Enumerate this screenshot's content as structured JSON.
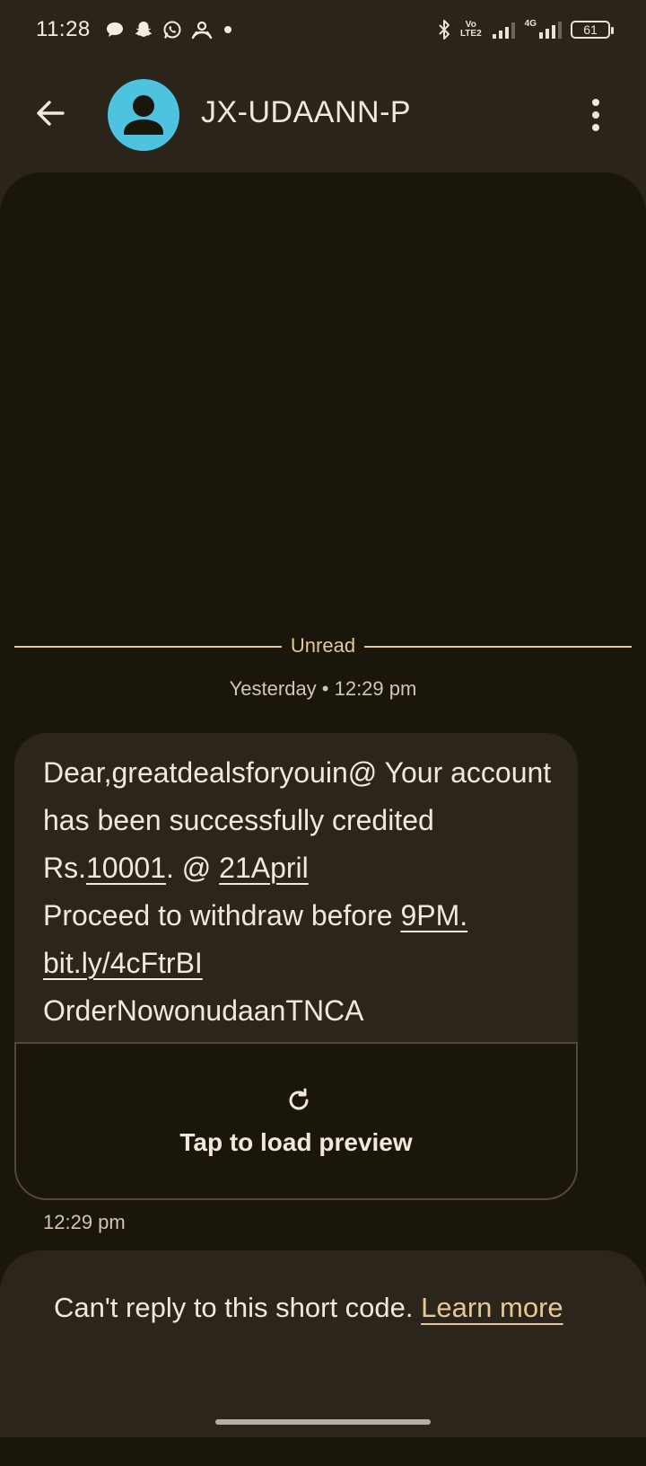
{
  "status_bar": {
    "time": "11:28",
    "network_label_top": "Vo",
    "network_label_bottom": "LTE2",
    "data_label": "4G",
    "battery": "61",
    "left_icons": [
      "chat-bubble-icon",
      "snapchat-icon",
      "whatsapp-icon",
      "app-notification-icon",
      "dot-icon"
    ],
    "right_icons": [
      "bluetooth-icon",
      "volte-icon",
      "signal-icon",
      "signal-4g-icon",
      "battery-icon"
    ]
  },
  "header": {
    "contact_name": "JX-UDAANN-P",
    "avatar_color": "#4dc3e0"
  },
  "conversation": {
    "unread_label": "Unread",
    "date_header": "Yesterday • 12:29 pm",
    "message": {
      "line1": "Dear,greatdealsforyouin@ Your account has been successfully credited Rs.",
      "amount": "10001",
      "mid": ". @ ",
      "date": "21April",
      "line2": "Proceed to withdraw before ",
      "deadline": "9PM.",
      "link": "bit.ly/4cFtrBI",
      "tail": "OrderNowonudaanTNCA"
    },
    "preview_label": "Tap to load preview",
    "message_time": "12:29 pm"
  },
  "reply_panel": {
    "text": "Can't reply to this short code. ",
    "learn_more": "Learn more"
  },
  "colors": {
    "accent": "#e6c796",
    "background": "#1a160c",
    "bubble": "#2b251c"
  }
}
